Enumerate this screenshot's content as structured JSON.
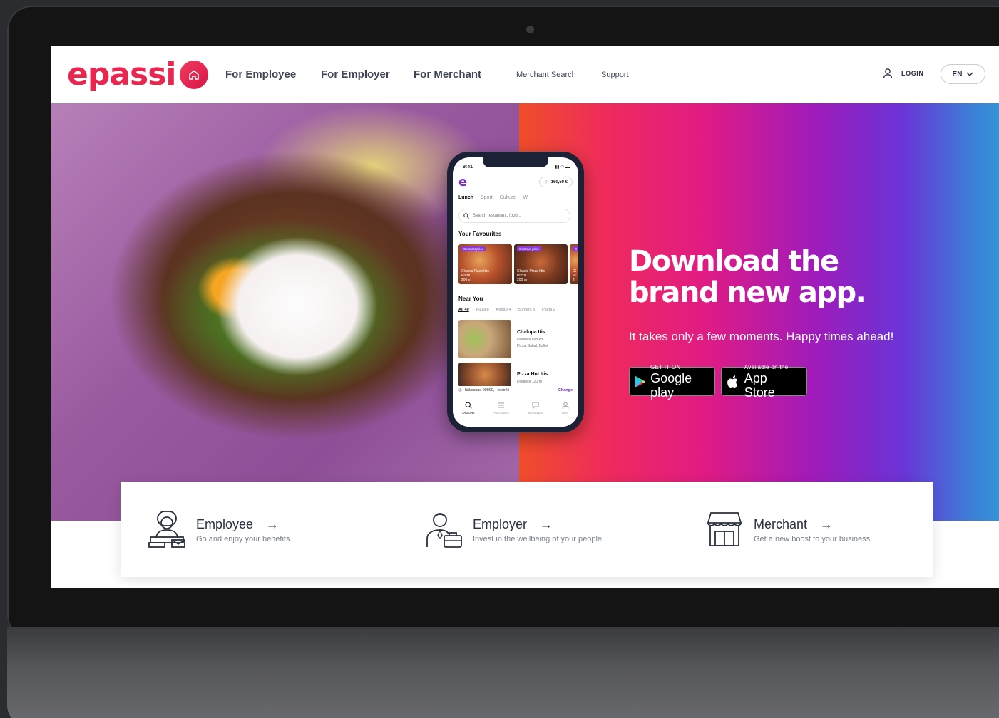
{
  "brand": {
    "logo_text": "epassi",
    "primary_color": "#e8264f",
    "accent_purple": "#7a2fc8"
  },
  "header": {
    "home_icon": "home-icon",
    "nav_primary": [
      "For Employee",
      "For Employer",
      "For Merchant"
    ],
    "nav_secondary": [
      "Merchant Search",
      "Support"
    ],
    "login_label": "LOGIN",
    "language": "EN"
  },
  "hero": {
    "title_line1": "Download the",
    "title_line2": "brand new app.",
    "subtitle": "It takes only a few moments. Happy times ahead!",
    "google_play": {
      "small": "GET IT ON",
      "big": "Google play"
    },
    "app_store": {
      "small": "Available on the",
      "big": "App Store"
    }
  },
  "phone": {
    "time": "9:41",
    "balance": "160,50 €",
    "categories": [
      "Lunch",
      "Sport",
      "Culture",
      "W"
    ],
    "search_placeholder": "Search restaurant, food...",
    "favourites_heading": "Your Favourites",
    "favourites": [
      {
        "badge": "Contract price",
        "name": "Classic Pizza Ittis",
        "type": "Pizza",
        "distance": "200 m"
      },
      {
        "badge": "Contract price",
        "name": "Classic Pizza Ittis",
        "type": "Pizza",
        "distance": "200 m"
      },
      {
        "badge": "C",
        "name": "Cl",
        "type": "Pi",
        "distance": "2"
      }
    ],
    "near_heading": "Near You",
    "near_tabs": [
      "All 40",
      "Pizza 8",
      "Kebab 4",
      "Burgers 3",
      "Pasta 2"
    ],
    "restaurants": [
      {
        "name": "Chalupa Itis",
        "distance": "Distance 698 km",
        "tags": "Pizza, Salad, Buffet"
      },
      {
        "name": "Pizza Hut Itis",
        "distance": "Distance 120 m",
        "tags": ""
      }
    ],
    "location": "Itäkeskus 00900, Helsinki",
    "change_label": "Change",
    "bottom_nav": [
      "Discover",
      "Purchases",
      "Messages",
      "User"
    ]
  },
  "cards": [
    {
      "title": "Employee",
      "desc": "Go and enjoy your benefits.",
      "icon": "employee-icon"
    },
    {
      "title": "Employer",
      "desc": "Invest in the wellbeing of your people.",
      "icon": "employer-icon"
    },
    {
      "title": "Merchant",
      "desc": "Get a new boost to your business.",
      "icon": "merchant-store-icon"
    }
  ],
  "arrow": "→"
}
